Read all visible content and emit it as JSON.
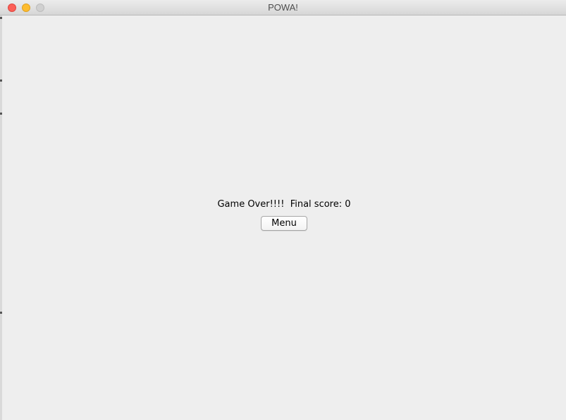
{
  "window": {
    "title": "POWA!"
  },
  "game_over": {
    "message": "Game Over!!!!  Final score: 0",
    "menu_button_label": "Menu"
  },
  "colors": {
    "background": "#eeeeee",
    "close": "#fc5f57",
    "minimize": "#fdbc2e",
    "zoom_disabled": "#d0d0d0"
  }
}
